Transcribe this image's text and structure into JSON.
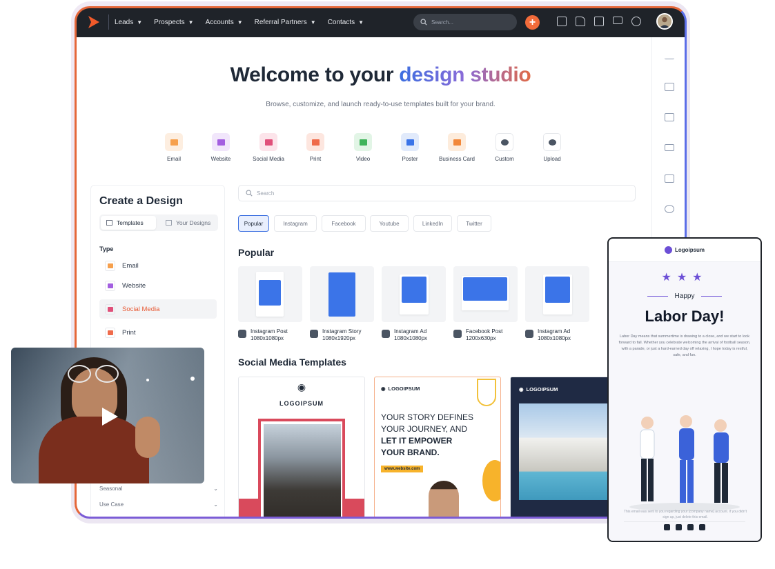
{
  "topbar": {
    "nav": [
      "Leads",
      "Prospects",
      "Accounts",
      "Referral Partners",
      "Contacts"
    ],
    "search_placeholder": "Search..."
  },
  "hero": {
    "title_prefix": "Welcome to your ",
    "title_highlight": "design studio",
    "subtitle": "Browse, customize, and launch ready-to-use templates built for your brand."
  },
  "categories": [
    {
      "label": "Email",
      "color": "#f6a04d",
      "bg": "#fdeee0"
    },
    {
      "label": "Website",
      "color": "#a35fe0",
      "bg": "#f1e6fb"
    },
    {
      "label": "Social Media",
      "color": "#e0507a",
      "bg": "#fce4ea"
    },
    {
      "label": "Print",
      "color": "#ef6b4b",
      "bg": "#fde6df"
    },
    {
      "label": "Video",
      "color": "#3fb45a",
      "bg": "#e2f5e6"
    },
    {
      "label": "Poster",
      "color": "#3b74e8",
      "bg": "#e1eafb"
    },
    {
      "label": "Business Card",
      "color": "#f2883a",
      "bg": "#fdecdc"
    },
    {
      "label": "Custom",
      "color": "#4b5563",
      "bg": "#ffffff"
    },
    {
      "label": "Upload",
      "color": "#4b5563",
      "bg": "#ffffff"
    }
  ],
  "left_panel": {
    "title": "Create a Design",
    "tab_templates": "Templates",
    "tab_your_designs": "Your Designs",
    "type_heading": "Type",
    "types": [
      "Email",
      "Website",
      "Social Media",
      "Print"
    ],
    "bottom_items": [
      "Seasonal",
      "Use Case"
    ]
  },
  "main": {
    "search_placeholder": "Search",
    "chips": [
      "Popular",
      "Instagram",
      "Facebook",
      "Youtube",
      "LinkedIn",
      "Twitter"
    ],
    "popular_title": "Popular",
    "popular_templates": [
      {
        "name": "Instagram Post",
        "size": "1080x1080px"
      },
      {
        "name": "Instagram Story",
        "size": "1080x1920px"
      },
      {
        "name": "Instagram Ad",
        "size": "1080x1080px"
      },
      {
        "name": "Facebook Post",
        "size": "1200x630px"
      },
      {
        "name": "Instagram Ad",
        "size": "1080x1080px"
      }
    ],
    "social_title": "Social Media Templates",
    "card1_brand": "LOGOIPSUM",
    "card2_brand": "LOGOIPSUM",
    "card2_line1": "YOUR STORY DEFINES",
    "card2_line2": "YOUR JOURNEY, AND",
    "card2_line3": "LET IT EMPOWER",
    "card2_line4": "YOUR BRAND.",
    "card2_url": "www.website.com",
    "card3_brand": "LOGOIPSUM"
  },
  "phone": {
    "brand": "Logoipsum",
    "happy": "Happy",
    "headline": "Labor Day!",
    "body": "Labor Day means that summertime is drawing to a close, and we start to look forward to fall. Whether you celebrate welcoming the arrival of football season, with a parade, or just a hard-earned day off relaxing, I hope today is restful, safe, and fun.",
    "footer": "This email was sent to you regarding your [company name] account. If you didn't sign up, just delete this email."
  }
}
